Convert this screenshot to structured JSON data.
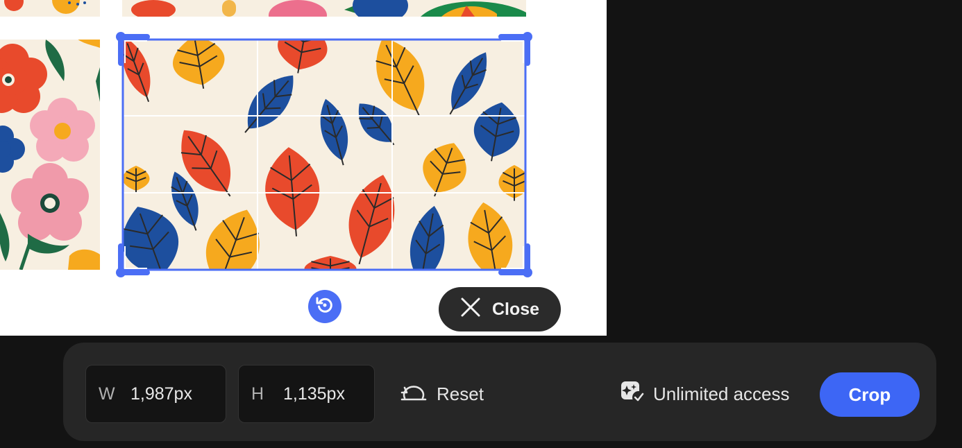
{
  "image_editor": {
    "close_label": "Close",
    "rotate_icon": "rotate-ccw-icon",
    "accent": "#4b6ef5"
  },
  "crop_toolbar": {
    "width_letter": "W",
    "width_value": "1,987px",
    "height_letter": "H",
    "height_value": "1,135px",
    "reset_label": "Reset",
    "access_label": "Unlimited access",
    "crop_label": "Crop",
    "crop_color": "#3d66f5",
    "background": "#262626"
  },
  "leaf_colors": {
    "red": "#e84a2c",
    "orange": "#f6a91e",
    "blue": "#1d4f9e",
    "cream": "#f7efe1"
  }
}
